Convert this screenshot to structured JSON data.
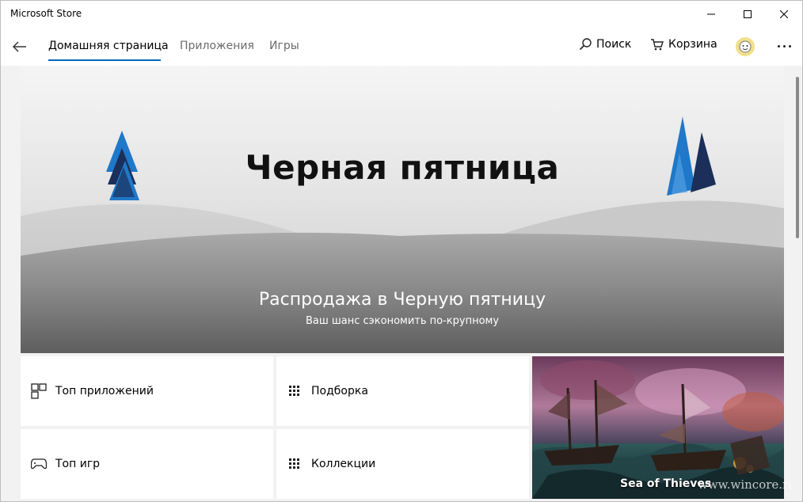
{
  "window": {
    "title": "Microsoft Store"
  },
  "nav": {
    "tabs": [
      {
        "label": "Домашняя страница",
        "active": true
      },
      {
        "label": "Приложения",
        "active": false
      },
      {
        "label": "Игры",
        "active": false
      }
    ],
    "search_label": "Поиск",
    "cart_label": "Корзина"
  },
  "hero": {
    "title": "Черная пятница",
    "subtitle": "Распродажа в Черную пятницу",
    "description": "Ваш шанс сэкономить по-крупному"
  },
  "tiles": [
    {
      "label": "Топ приложений",
      "icon": "apps-grid-icon"
    },
    {
      "label": "Подборка",
      "icon": "dots-grid-icon"
    },
    {
      "label": "Топ игр",
      "icon": "gamepad-icon"
    },
    {
      "label": "Коллекции",
      "icon": "dots-grid-icon"
    }
  ],
  "featured": {
    "label": "Sea of Thieves"
  },
  "watermark": "www.wincore.ru",
  "colors": {
    "accent": "#0067c0",
    "tree_blue": "#1f78c9",
    "tree_dark": "#1b2f5a"
  }
}
